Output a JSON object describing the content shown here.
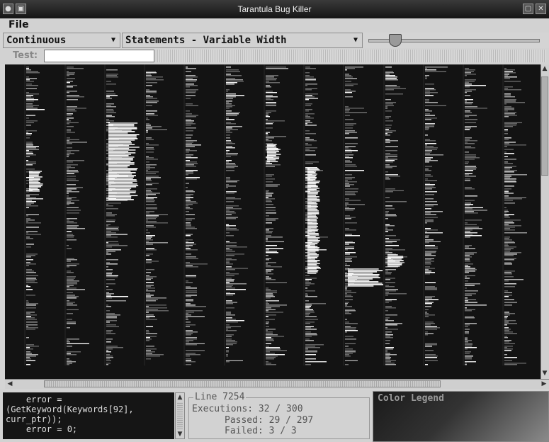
{
  "window": {
    "title": "Tarantula Bug Killer"
  },
  "menu": {
    "file": "File"
  },
  "toolbar": {
    "mode_select": "Continuous",
    "view_select": "Statements - Variable Width",
    "slider_value_fraction": 0.18
  },
  "test": {
    "label": "Test:",
    "value": ""
  },
  "source": {
    "lines": [
      "    error =",
      "(GetKeyword(Keywords[92],",
      "curr_ptr));",
      "    error = 0;"
    ]
  },
  "info": {
    "title": "Line 7254",
    "executions": "Executions: 32 / 300",
    "passed": "Passed: 29 / 297",
    "failed": "Failed: 3 / 3"
  },
  "legend": {
    "title": "Color Legend"
  },
  "colors": {
    "canvas": "#131313",
    "highlight": "#f2f2f2",
    "dim": "#6a6a6a",
    "mid": "#a8a8a8"
  }
}
